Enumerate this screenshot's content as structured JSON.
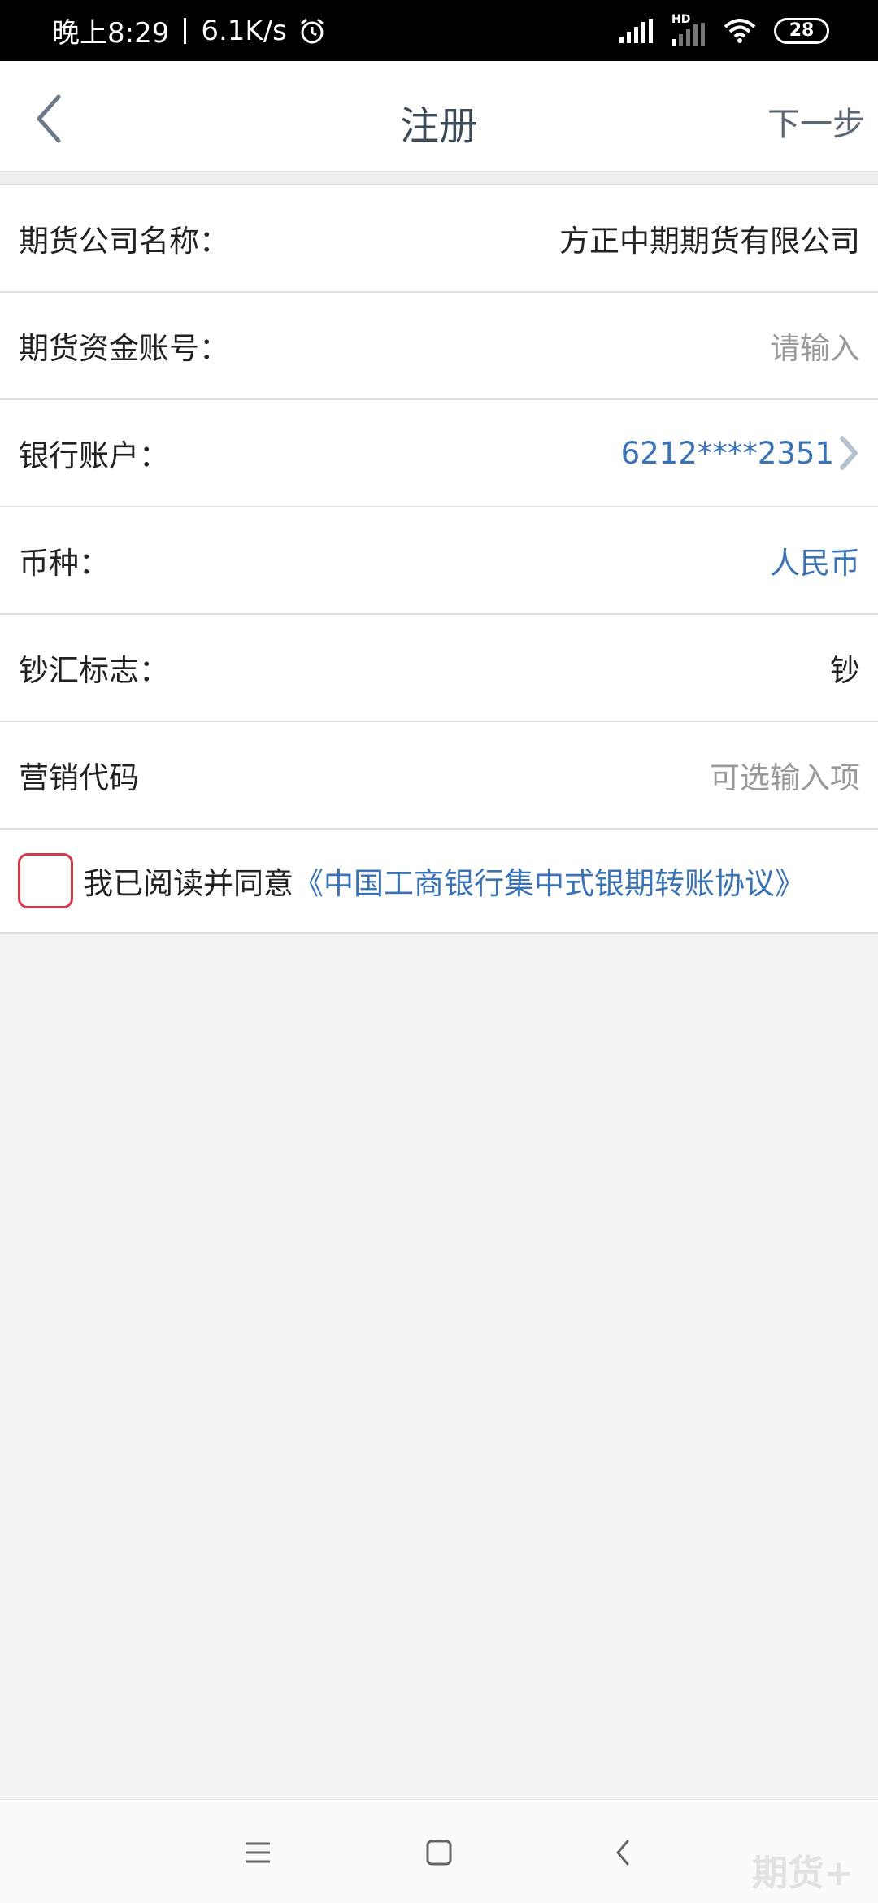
{
  "status_bar": {
    "time": "晚上8:29",
    "speed": "6.1K/s",
    "hd_label": "HD",
    "battery": "28"
  },
  "header": {
    "title": "注册",
    "next_label": "下一步"
  },
  "form": {
    "rows": [
      {
        "label": "期货公司名称：",
        "value": "方正中期期货有限公司"
      },
      {
        "label": "期货资金账号：",
        "placeholder": "请输入"
      },
      {
        "label": "银行账户：",
        "value": "6212****2351"
      },
      {
        "label": "币种：",
        "value": "人民币"
      },
      {
        "label": "钞汇标志：",
        "value": "钞"
      },
      {
        "label": "营销代码",
        "placeholder": "可选输入项"
      }
    ]
  },
  "agreement": {
    "text": "我已阅读并同意",
    "link": "《中国工商银行集中式银期转账协议》"
  },
  "watermark": "期货+",
  "colors": {
    "accent_blue": "#3a73b5",
    "checkbox_red": "#d23a4a",
    "background": "#f2f2f2"
  }
}
